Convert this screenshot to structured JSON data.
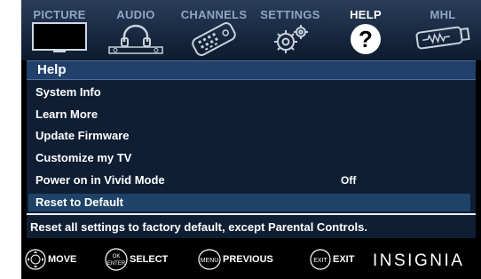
{
  "tabs": [
    {
      "label": "PICTURE",
      "icon": "tv-icon"
    },
    {
      "label": "AUDIO",
      "icon": "headphones-icon"
    },
    {
      "label": "CHANNELS",
      "icon": "remote-icon"
    },
    {
      "label": "SETTINGS",
      "icon": "gears-icon"
    },
    {
      "label": "HELP",
      "icon": "help-icon",
      "active": true
    },
    {
      "label": "MHL",
      "icon": "mhl-icon"
    }
  ],
  "panel": {
    "title": "Help",
    "items": [
      {
        "label": "System Info",
        "value": ""
      },
      {
        "label": "Learn More",
        "value": ""
      },
      {
        "label": "Update Firmware",
        "value": ""
      },
      {
        "label": "Customize my TV",
        "value": ""
      },
      {
        "label": "Power on in Vivid Mode",
        "value": "Off"
      },
      {
        "label": "Reset to Default",
        "value": "",
        "selected": true
      }
    ],
    "description": "Reset all settings to factory default, except Parental Controls."
  },
  "hints": [
    {
      "label": "MOVE",
      "key": ""
    },
    {
      "key_top": "OK",
      "key_bottom": "ENTER",
      "label": "SELECT"
    },
    {
      "key": "MENU",
      "label": "PREVIOUS"
    },
    {
      "key": "EXIT",
      "label": "EXIT"
    }
  ],
  "brand": "INSIGNIA",
  "colors": {
    "selected_row": "#1f4368",
    "title_bar": "#21406b",
    "panel_bg": "#0f1e33"
  }
}
